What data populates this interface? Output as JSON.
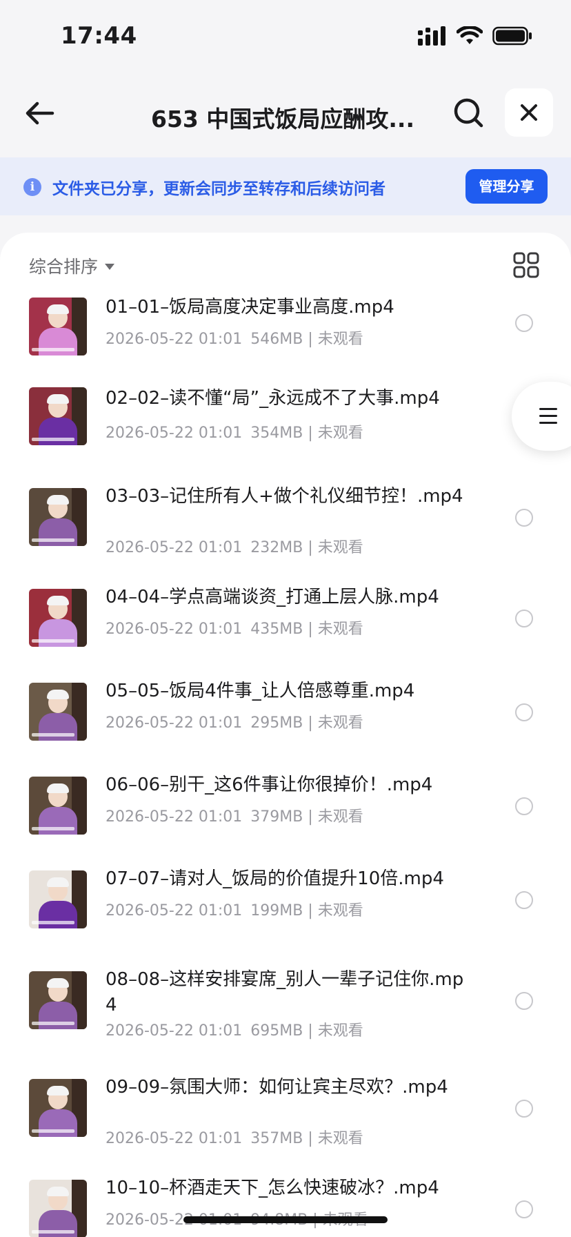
{
  "status_bar": {
    "time": "17:44"
  },
  "nav": {
    "title": "653 中国式饭局应酬攻..."
  },
  "banner": {
    "message": "文件夹已分享，更新会同步至转存和后续访问者",
    "manage_label": "管理分享"
  },
  "sort": {
    "label": "综合排序"
  },
  "files": [
    {
      "name": "01–01–饭局高度决定事业高度.mp4",
      "date": "2026-05-22 01:01",
      "size": "546MB",
      "status": "未观看",
      "thumb_bg": "#a3324a",
      "thumb_body": "#d98ad6"
    },
    {
      "name": "02–02–读不懂“局”_永远成不了大事.mp4",
      "date": "2026-05-22 01:01",
      "size": "354MB",
      "status": "未观看",
      "thumb_bg": "#8a2f3c",
      "thumb_body": "#6a2fa3"
    },
    {
      "name": "03–03–记住所有人+做个礼仪细节控！.mp4",
      "date": "2026-05-22 01:01",
      "size": "232MB",
      "status": "未观看",
      "thumb_bg": "#5a4a3c",
      "thumb_body": "#8c5ea8"
    },
    {
      "name": "04–04–学点高端谈资_打通上层人脉.mp4",
      "date": "2026-05-22 01:01",
      "size": "435MB",
      "status": "未观看",
      "thumb_bg": "#9b2f3c",
      "thumb_body": "#c896e0"
    },
    {
      "name": "05–05–饭局4件事_让人倍感尊重.mp4",
      "date": "2026-05-22 01:01",
      "size": "295MB",
      "status": "未观看",
      "thumb_bg": "#6b5a48",
      "thumb_body": "#8c5ea8"
    },
    {
      "name": "06–06–别干_这6件事让你很掉价！.mp4",
      "date": "2026-05-22 01:01",
      "size": "379MB",
      "status": "未观看",
      "thumb_bg": "#5c4a3a",
      "thumb_body": "#9a6ab8"
    },
    {
      "name": "07–07–请对人_饭局的价值提升10倍.mp4",
      "date": "2026-05-22 01:01",
      "size": "199MB",
      "status": "未观看",
      "thumb_bg": "#e8e2dc",
      "thumb_body": "#6a2fa3"
    },
    {
      "name": "08–08–这样安排宴席_别人一辈子记住你.mp4",
      "date": "2026-05-22 01:01",
      "size": "695MB",
      "status": "未观看",
      "thumb_bg": "#5c4a3a",
      "thumb_body": "#8c5ea8"
    },
    {
      "name": "09–09–氛围大师：如何让宾主尽欢？.mp4",
      "date": "2026-05-22 01:01",
      "size": "357MB",
      "status": "未观看",
      "thumb_bg": "#5c4a3a",
      "thumb_body": "#9a6ab8"
    },
    {
      "name": "10–10–杯酒走天下_怎么快速破冰？.mp4",
      "date": "2026-05-22 01:01",
      "size": "94.8MB",
      "status": "未观看",
      "thumb_bg": "#e8e2dc",
      "thumb_body": "#8c5ea8"
    }
  ]
}
